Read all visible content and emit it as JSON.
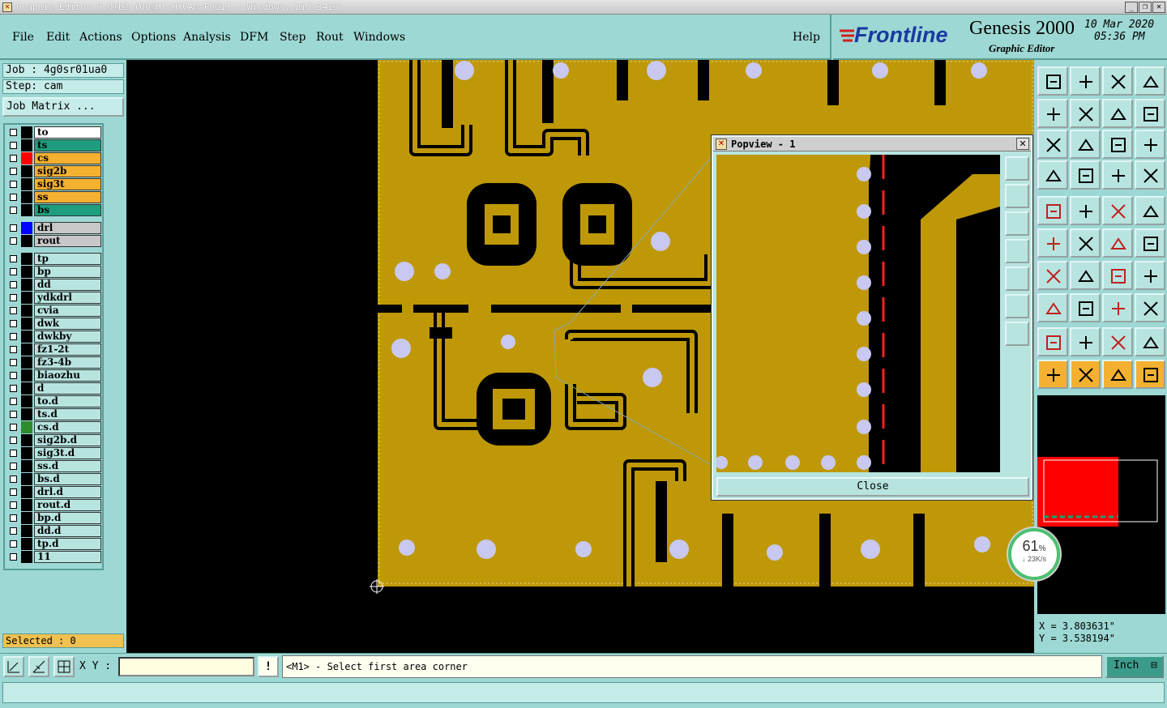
{
  "window": {
    "title": "Graphic Editor 9.0?b2 (OO@HY-HYCAM-PC017 - Windows, pid:3416)",
    "controls": [
      "_",
      "❐",
      "✕"
    ]
  },
  "menu": [
    "File",
    "Edit",
    "Actions",
    "Options",
    "Analysis",
    "DFM",
    "Step",
    "Rout",
    "Windows"
  ],
  "help_label": "Help",
  "brand": {
    "logo": "Frontline",
    "product": "Genesis 2000",
    "subtitle": "Graphic Editor",
    "date": "10 Mar 2020",
    "time": "05:36 PM"
  },
  "job": {
    "job_label": "Job : 4g0sr01ua0",
    "step_label": "Step: cam",
    "matrix_button": "Job Matrix ..."
  },
  "layers": [
    {
      "name": "to",
      "color": "#ffffff",
      "swatch": "#000000"
    },
    {
      "name": "ts",
      "color": "#1e9e7e",
      "swatch": "#000000"
    },
    {
      "name": "cs",
      "color": "#f4b030",
      "swatch": "#ff0000"
    },
    {
      "name": "sig2b",
      "color": "#f4b030",
      "swatch": "#000000"
    },
    {
      "name": "sig3t",
      "color": "#f4b030",
      "swatch": "#000000"
    },
    {
      "name": "ss",
      "color": "#f4b030",
      "swatch": "#000000"
    },
    {
      "name": "bs",
      "color": "#1e9e7e",
      "swatch": "#000000"
    },
    {
      "name": "drl",
      "color": "#c8c8c8",
      "swatch": "#0000ff"
    },
    {
      "name": "rout",
      "color": "#c8c8c8",
      "swatch": "#000000"
    },
    {
      "name": "tp",
      "color": "#b8e4e0",
      "swatch": "#000000"
    },
    {
      "name": "bp",
      "color": "#b8e4e0",
      "swatch": "#000000"
    },
    {
      "name": "dd",
      "color": "#b8e4e0",
      "swatch": "#000000"
    },
    {
      "name": "ydkdrl",
      "color": "#b8e4e0",
      "swatch": "#000000"
    },
    {
      "name": "cvia",
      "color": "#b8e4e0",
      "swatch": "#000000"
    },
    {
      "name": "dwk",
      "color": "#b8e4e0",
      "swatch": "#000000"
    },
    {
      "name": "dwkby",
      "color": "#b8e4e0",
      "swatch": "#000000"
    },
    {
      "name": "fz1-2t",
      "color": "#b8e4e0",
      "swatch": "#000000"
    },
    {
      "name": "fz3-4b",
      "color": "#b8e4e0",
      "swatch": "#000000"
    },
    {
      "name": "biaozhu",
      "color": "#b8e4e0",
      "swatch": "#000000"
    },
    {
      "name": "d",
      "color": "#b8e4e0",
      "swatch": "#000000"
    },
    {
      "name": "to.d",
      "color": "#b8e4e0",
      "swatch": "#000000"
    },
    {
      "name": "ts.d",
      "color": "#b8e4e0",
      "swatch": "#000000"
    },
    {
      "name": "cs.d",
      "color": "#b8e4e0",
      "swatch": "#2e8b2e"
    },
    {
      "name": "sig2b.d",
      "color": "#b8e4e0",
      "swatch": "#000000"
    },
    {
      "name": "sig3t.d",
      "color": "#b8e4e0",
      "swatch": "#000000"
    },
    {
      "name": "ss.d",
      "color": "#b8e4e0",
      "swatch": "#000000"
    },
    {
      "name": "bs.d",
      "color": "#b8e4e0",
      "swatch": "#000000"
    },
    {
      "name": "drl.d",
      "color": "#b8e4e0",
      "swatch": "#000000"
    },
    {
      "name": "rout.d",
      "color": "#b8e4e0",
      "swatch": "#000000"
    },
    {
      "name": "bp.d",
      "color": "#b8e4e0",
      "swatch": "#000000"
    },
    {
      "name": "dd.d",
      "color": "#b8e4e0",
      "swatch": "#000000"
    },
    {
      "name": "tp.d",
      "color": "#b8e4e0",
      "swatch": "#000000"
    },
    {
      "name": "11",
      "color": "#b8e4e0",
      "swatch": "#000000"
    }
  ],
  "selected_label": "Selected : 0",
  "popview": {
    "title": "Popview - 1",
    "close_label": "Close"
  },
  "coords": {
    "x": "X = 3.803631\"",
    "y": "Y = 3.538194\""
  },
  "status": {
    "xy_label": "X Y :",
    "xy_value": "",
    "warn_icon": "!",
    "prompt": "<M1> - Select first area corner",
    "unit": "Inch"
  },
  "net_meter": {
    "percent": "61",
    "percent_sign": "%",
    "speed": "23K/s"
  },
  "colors": {
    "copper": "#bf9808",
    "pad": "#c8c8f0",
    "background": "#000000",
    "panel": "#9dd8d4"
  }
}
